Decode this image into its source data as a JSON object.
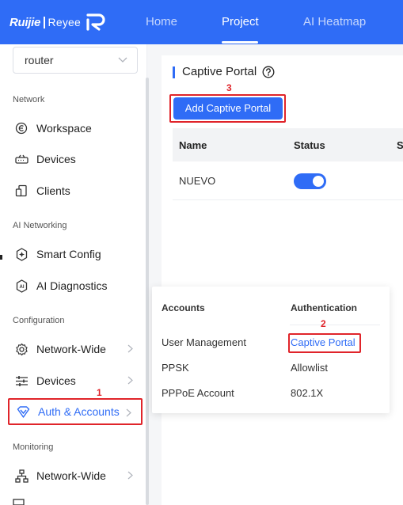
{
  "header": {
    "brand": "Ruijie",
    "product": "Reyee",
    "nav": [
      {
        "label": "Home",
        "active": false
      },
      {
        "label": "Project",
        "active": true
      },
      {
        "label": "AI Heatmap",
        "active": false
      }
    ]
  },
  "sidebar": {
    "project_select_value": "router",
    "sections": {
      "network": "Network",
      "ai_networking": "AI Networking",
      "configuration": "Configuration",
      "monitoring": "Monitoring"
    },
    "items": [
      {
        "label": "Workspace",
        "icon": "workspace-icon"
      },
      {
        "label": "Devices",
        "icon": "devices-icon"
      },
      {
        "label": "Clients",
        "icon": "clients-icon"
      },
      {
        "label": "Smart Config",
        "icon": "smart-config-icon"
      },
      {
        "label": "AI Diagnostics",
        "icon": "ai-diagnostics-icon"
      },
      {
        "label": "Network-Wide",
        "icon": "gear-icon"
      },
      {
        "label": "Devices",
        "icon": "sliders-icon"
      },
      {
        "label": "Auth & Accounts",
        "icon": "shield-icon",
        "selected": true
      },
      {
        "label": "Network-Wide",
        "icon": "topology-icon"
      }
    ]
  },
  "popup": {
    "accounts_header": "Accounts",
    "authentication_header": "Authentication",
    "accounts_items": [
      "User Management",
      "PPSK",
      "PPPoE Account"
    ],
    "authentication_items": [
      "Captive Portal",
      "Allowlist",
      "802.1X"
    ]
  },
  "main": {
    "title": "Captive Portal",
    "add_button": "Add Captive Portal",
    "columns": [
      "Name",
      "Status",
      "S"
    ],
    "rows": [
      {
        "name": "NUEVO",
        "status_on": true
      }
    ]
  },
  "annotations": {
    "step1": "1",
    "step2": "2",
    "step3": "3"
  },
  "colors": {
    "accent": "#2f6cf6",
    "highlight": "#e0242a"
  }
}
